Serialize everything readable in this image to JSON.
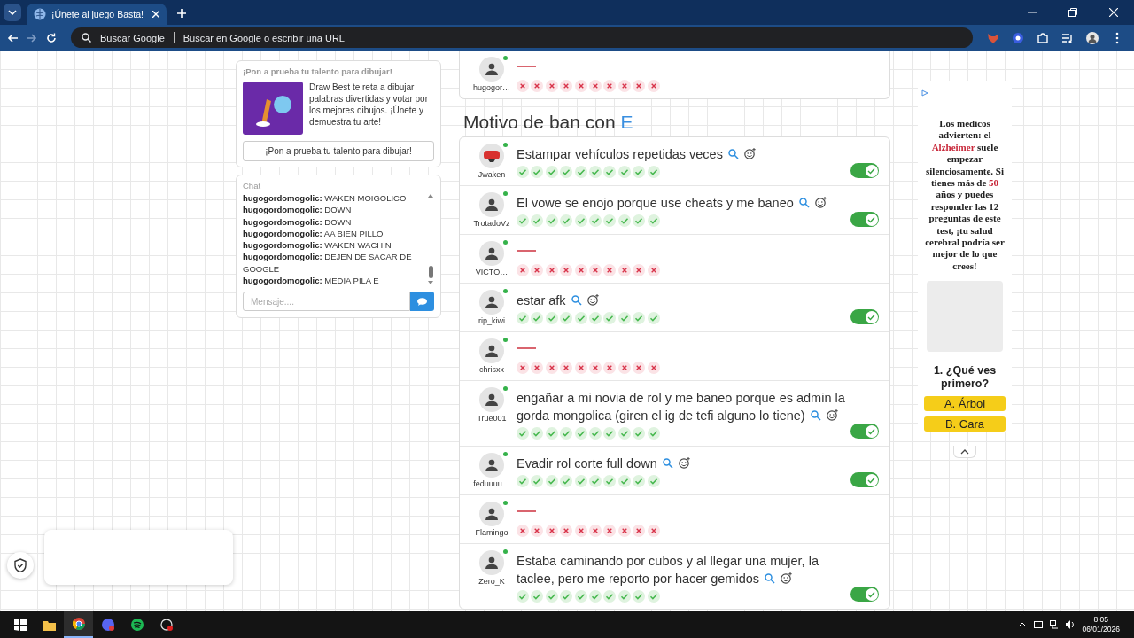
{
  "browser": {
    "tab_title": "¡Únete al juego Basta!",
    "search_engine": "Buscar Google",
    "address_placeholder": "Buscar en Google o escribir una URL"
  },
  "promo": {
    "title": "¡Pon a prueba tu talento para dibujar!",
    "description": "Draw Best te reta a dibujar palabras divertidas y votar por los mejores dibujos. ¡Únete y demuestra tu arte!",
    "button": "¡Pon a prueba tu talento para dibujar!"
  },
  "chat": {
    "title": "Chat",
    "messages": [
      {
        "user": "hugogordomogolic:",
        "text": "WAKEN MOIGOLICO"
      },
      {
        "user": "hugogordomogolic:",
        "text": "DOWN"
      },
      {
        "user": "hugogordomogolic:",
        "text": "DOWN"
      },
      {
        "user": "hugogordomogolic:",
        "text": "AA BIEN PILLO"
      },
      {
        "user": "hugogordomogolic:",
        "text": "WAKEN WACHIN"
      },
      {
        "user": "hugogordomogolic:",
        "text": "DEJEN DE SACAR DE GOOGLE"
      },
      {
        "user": "hugogordomogolic:",
        "text": "MEDIA PILA E"
      }
    ],
    "placeholder": "Mensaje...."
  },
  "previous_card": {
    "rows": [
      {
        "kind": "blank",
        "stop_avatar": false,
        "online": true,
        "name": "hugogor…",
        "votes": [
          false,
          false,
          false,
          false,
          false,
          false,
          false,
          false,
          false,
          false
        ]
      }
    ]
  },
  "section": {
    "heading": "Motivo de ban con",
    "letter": "E",
    "rows": [
      {
        "kind": "answer",
        "stop_avatar": true,
        "online": true,
        "name": "Jwaken",
        "answer": "Estampar vehículos repetidas veces",
        "on": true,
        "votes": [
          true,
          true,
          true,
          true,
          true,
          true,
          true,
          true,
          true,
          true
        ]
      },
      {
        "kind": "answer",
        "stop_avatar": false,
        "online": true,
        "name": "TrotadoVz",
        "answer": "El vowe se enojo porque use cheats y me baneo",
        "on": true,
        "votes": [
          true,
          true,
          true,
          true,
          true,
          true,
          true,
          true,
          true,
          true
        ]
      },
      {
        "kind": "blank",
        "stop_avatar": false,
        "online": true,
        "name": "VICTO…",
        "votes": [
          false,
          false,
          false,
          false,
          false,
          false,
          false,
          false,
          false,
          false
        ]
      },
      {
        "kind": "answer",
        "stop_avatar": false,
        "online": true,
        "name": "rip_kiwi",
        "answer": "estar afk",
        "on": true,
        "votes": [
          true,
          true,
          true,
          true,
          true,
          true,
          true,
          true,
          true,
          true
        ]
      },
      {
        "kind": "blank",
        "stop_avatar": false,
        "online": true,
        "name": "chrisxx",
        "votes": [
          false,
          false,
          false,
          false,
          false,
          false,
          false,
          false,
          false,
          false
        ]
      },
      {
        "kind": "answer",
        "stop_avatar": false,
        "online": true,
        "name": "True001",
        "answer": "engañar a mi novia de rol y me baneo porque es admin la gorda mongolica (giren el ig de tefi alguno lo tiene)",
        "on": true,
        "votes": [
          true,
          true,
          true,
          true,
          true,
          true,
          true,
          true,
          true,
          true
        ]
      },
      {
        "kind": "answer",
        "stop_avatar": false,
        "online": true,
        "name": "feduuuu…",
        "answer": "Evadir rol corte full down",
        "on": true,
        "votes": [
          true,
          true,
          true,
          true,
          true,
          true,
          true,
          true,
          true,
          true
        ]
      },
      {
        "kind": "blank",
        "stop_avatar": false,
        "online": true,
        "name": "Flamingo",
        "votes": [
          false,
          false,
          false,
          false,
          false,
          false,
          false,
          false,
          false,
          false
        ]
      },
      {
        "kind": "answer",
        "stop_avatar": false,
        "online": true,
        "name": "Zero_K",
        "answer": "Estaba caminando por cubos y al llegar una mujer, la taclee, pero me reporto por hacer gemidos",
        "on": true,
        "votes": [
          true,
          true,
          true,
          true,
          true,
          true,
          true,
          true,
          true,
          true
        ]
      }
    ]
  },
  "ad": {
    "paragraph": [
      {
        "text": "Los médicos advierten: el ",
        "highlight": false
      },
      {
        "text": "Alzheimer",
        "highlight": true
      },
      {
        "text": " suele empezar silenciosamente. Si tienes más de ",
        "highlight": false
      },
      {
        "text": "50",
        "highlight": true
      },
      {
        "text": " años y puedes responder las 12 preguntas de este test, ¡tu salud cerebral podría ser mejor de lo que crees!",
        "highlight": false
      }
    ],
    "question": "1. ¿Qué ves primero?",
    "options": [
      "A. Árbol",
      "B. Cara"
    ]
  },
  "taskbar": {
    "time": "8:05",
    "date": "06/01/2026"
  }
}
